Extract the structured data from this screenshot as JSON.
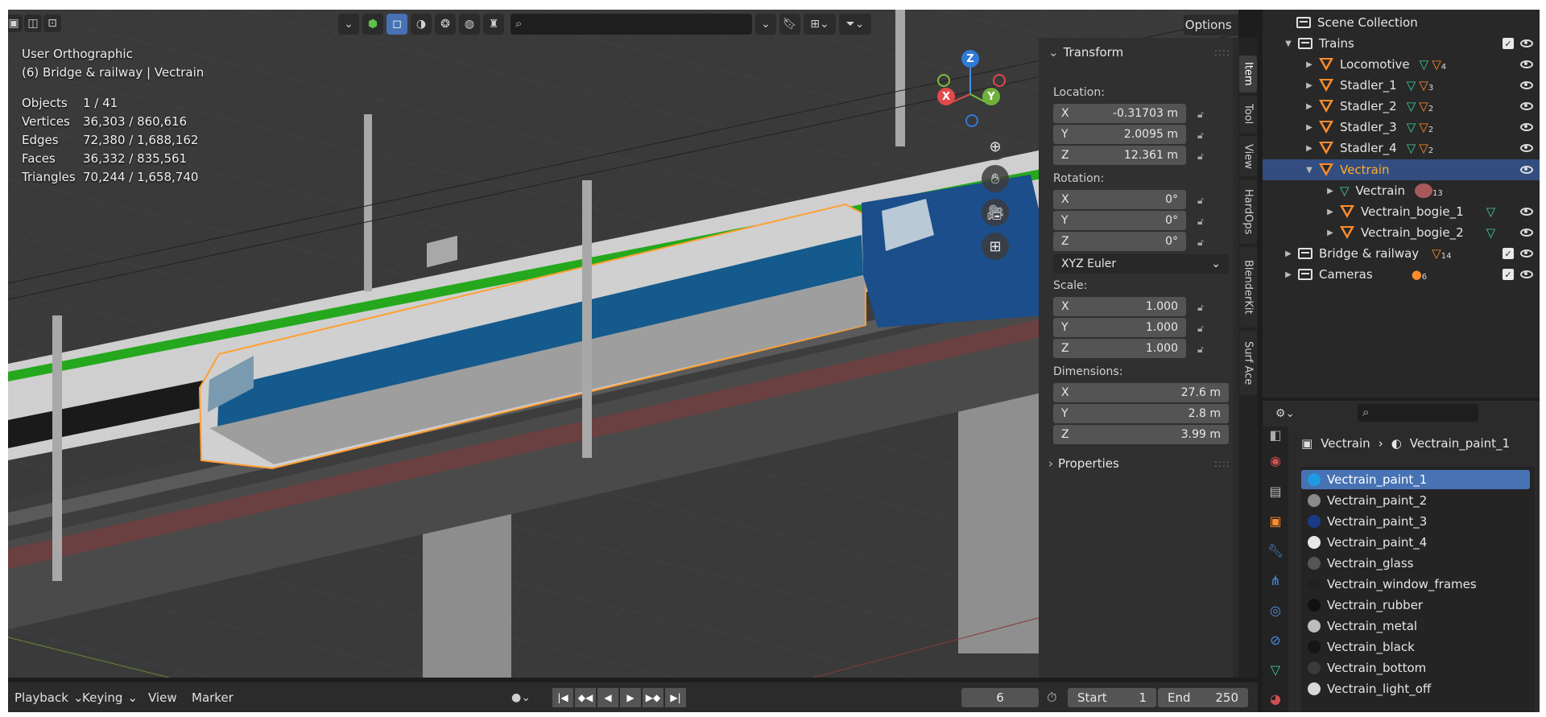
{
  "viewport": {
    "view_name": "User Orthographic",
    "context": "(6) Bridge & railway | Vectrain",
    "stats": [
      {
        "label": "Objects",
        "value": "1 / 41"
      },
      {
        "label": "Vertices",
        "value": "36,303 / 860,616"
      },
      {
        "label": "Edges",
        "value": "72,380 / 1,688,162"
      },
      {
        "label": "Faces",
        "value": "36,332 / 835,561"
      },
      {
        "label": "Triangles",
        "value": "70,244 / 1,658,740"
      }
    ],
    "options_label": "Options",
    "gizmo": {
      "x": "X",
      "y": "Y",
      "z": "Z"
    }
  },
  "npanel": {
    "transform_title": "Transform",
    "location_label": "Location:",
    "location": {
      "x": "-0.31703 m",
      "y": "2.0095 m",
      "z": "12.361 m"
    },
    "rotation_label": "Rotation:",
    "rotation": {
      "x": "0°",
      "y": "0°",
      "z": "0°"
    },
    "rotation_mode": "XYZ Euler",
    "scale_label": "Scale:",
    "scale": {
      "x": "1.000",
      "y": "1.000",
      "z": "1.000"
    },
    "dimensions_label": "Dimensions:",
    "dimensions": {
      "x": "27.6 m",
      "y": "2.8 m",
      "z": "3.99 m"
    },
    "properties_title": "Properties",
    "axis": {
      "x": "X",
      "y": "Y",
      "z": "Z"
    }
  },
  "tabs": [
    "Item",
    "Tool",
    "View",
    "HardOps",
    "BlenderKit",
    "Surf Ace"
  ],
  "outliner": {
    "root": "Scene Collection",
    "trains": "Trains",
    "children": [
      {
        "name": "Locomotive",
        "count": "4"
      },
      {
        "name": "Stadler_1",
        "count": "3"
      },
      {
        "name": "Stadler_2",
        "count": "2"
      },
      {
        "name": "Stadler_3",
        "count": "2"
      },
      {
        "name": "Stadler_4",
        "count": "2"
      }
    ],
    "vectrain": "Vectrain",
    "vectrain_children": [
      {
        "name": "Vectrain",
        "count": "13"
      },
      {
        "name": "Vectrain_bogie_1"
      },
      {
        "name": "Vectrain_bogie_2"
      }
    ],
    "bridge": "Bridge & railway",
    "bridge_count": "14",
    "cameras": "Cameras",
    "cameras_count": "6"
  },
  "properties": {
    "crumb_object": "Vectrain",
    "crumb_material": "Vectrain_paint_1",
    "materials": [
      {
        "name": "Vectrain_paint_1",
        "color": "#1e9be0"
      },
      {
        "name": "Vectrain_paint_2",
        "color": "#8a8a8a"
      },
      {
        "name": "Vectrain_paint_3",
        "color": "#1a3a8a"
      },
      {
        "name": "Vectrain_paint_4",
        "color": "#e8e8e8"
      },
      {
        "name": "Vectrain_glass",
        "color": "#555555"
      },
      {
        "name": "Vectrain_window_frames",
        "color": "#202020"
      },
      {
        "name": "Vectrain_rubber",
        "color": "#111111"
      },
      {
        "name": "Vectrain_metal",
        "color": "#bdbdbd"
      },
      {
        "name": "Vectrain_black",
        "color": "#151515"
      },
      {
        "name": "Vectrain_bottom",
        "color": "#3a3a3a"
      },
      {
        "name": "Vectrain_light_off",
        "color": "#d8d8d8"
      }
    ]
  },
  "timeline": {
    "playback": "Playback",
    "keying": "Keying",
    "view": "View",
    "marker": "Marker",
    "current_frame": "6",
    "start_label": "Start",
    "start": "1",
    "end_label": "End",
    "end": "250"
  }
}
